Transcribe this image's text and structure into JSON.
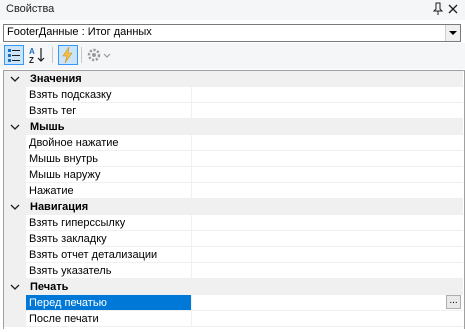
{
  "window": {
    "title": "Свойства"
  },
  "object_selector": {
    "value": "FooterДанные : Итог данных"
  },
  "toolbar": {
    "buttons": [
      {
        "icon": "categorized-icon",
        "selected": true
      },
      {
        "icon": "alphabetical-icon",
        "selected": false
      },
      {
        "icon": "events-icon",
        "selected": true
      },
      {
        "icon": "settings-icon",
        "selected": false
      }
    ]
  },
  "grid": {
    "rows": [
      {
        "type": "category",
        "label": "Значения"
      },
      {
        "type": "property",
        "label": "Взять подсказку"
      },
      {
        "type": "property",
        "label": "Взять тег"
      },
      {
        "type": "category",
        "label": "Мышь"
      },
      {
        "type": "property",
        "label": "Двойное нажатие"
      },
      {
        "type": "property",
        "label": "Мышь внутрь"
      },
      {
        "type": "property",
        "label": "Мышь наружу"
      },
      {
        "type": "property",
        "label": "Нажатие"
      },
      {
        "type": "category",
        "label": "Навигация"
      },
      {
        "type": "property",
        "label": "Взять гиперссылку"
      },
      {
        "type": "property",
        "label": "Взять закладку"
      },
      {
        "type": "property",
        "label": "Взять отчет детализации"
      },
      {
        "type": "property",
        "label": "Взять указатель"
      },
      {
        "type": "category",
        "label": "Печать"
      },
      {
        "type": "property",
        "label": "Перед печатью",
        "selected": true,
        "ellipsis": "..."
      },
      {
        "type": "property",
        "label": "После печати"
      }
    ]
  },
  "colors": {
    "selection": "#0078d7",
    "category_bg": "#f0f0f0",
    "toolbar_bg": "#f5f6f7"
  }
}
